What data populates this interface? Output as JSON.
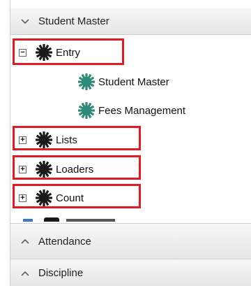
{
  "sections": {
    "student_master": {
      "label": "Student Master"
    },
    "attendance": {
      "label": "Attendance"
    },
    "discipline": {
      "label": "Discipline"
    }
  },
  "tree": {
    "entry": {
      "label": "Entry",
      "toggle": "−",
      "children": [
        {
          "label": "Student Master"
        },
        {
          "label": "Fees Management"
        }
      ]
    },
    "lists": {
      "label": "Lists",
      "toggle": "+"
    },
    "loaders": {
      "label": "Loaders",
      "toggle": "+"
    },
    "count": {
      "label": "Count",
      "toggle": "+"
    }
  },
  "icons": {
    "folder_gear": "gear-icon-dark",
    "leaf_gear": "gear-icon-teal"
  },
  "colors": {
    "highlight": "#e01b24",
    "gear_dark": "#1a1a1a",
    "gear_teal": "#2e8b7a"
  }
}
